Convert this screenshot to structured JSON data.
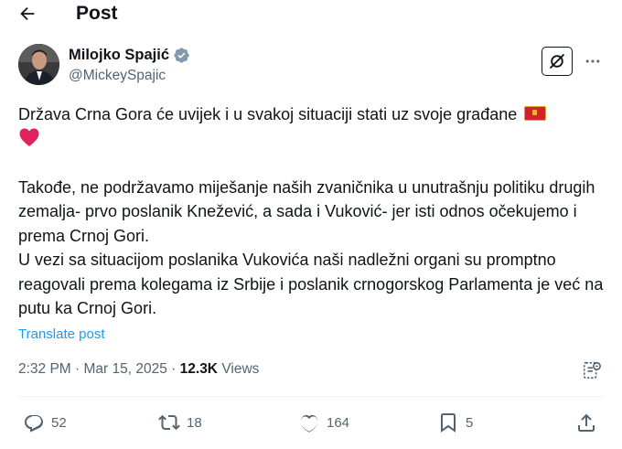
{
  "header": {
    "title": "Post",
    "back_icon": "arrow-left-icon"
  },
  "author": {
    "name": "Milojko Spajić",
    "handle": "@MickeySpajic",
    "verified": true
  },
  "post": {
    "line1": "Država Crna Gora će uvijek i u svakoj situaciji stati uz svoje građane",
    "paragraph2": "Takođe, ne podržavamo miješanje naših zvaničnika u unutrašnju politiku drugih zemalja- prvo poslanik Knežević, a sada i Vuković- jer isti odnos očekujemo i prema Crnoj Gori.",
    "paragraph3": "U vezi sa situacijom poslanika Vukovića naši nadležni organi su promptno reagovali prema kolegama iz Srbije i poslanik crnogorskog Parlamenta je već na putu ka Crnoj Gori.",
    "translate_label": "Translate post"
  },
  "meta": {
    "time": "2:32 PM",
    "separator": " · ",
    "date": "Mar 15, 2025",
    "views_count": "12.3K",
    "views_label": "Views"
  },
  "actions": {
    "replies": "52",
    "reposts": "18",
    "likes": "164",
    "bookmarks": "5"
  },
  "colors": {
    "accent": "#1d9bf0",
    "muted": "#536471",
    "text": "#0f1419",
    "flag_red": "#d3202a",
    "heart": "#e0245e"
  }
}
